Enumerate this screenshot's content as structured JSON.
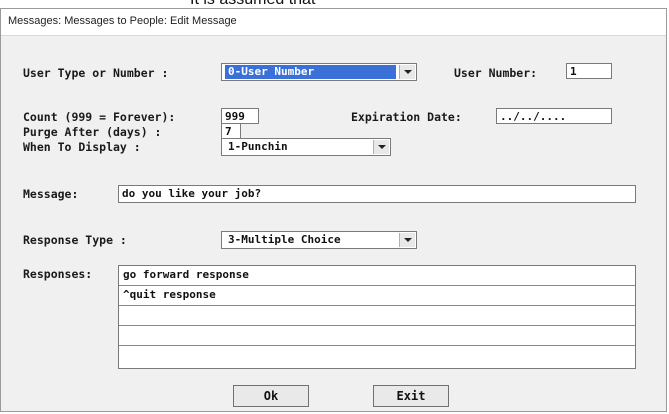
{
  "caption": "It is assumed that",
  "window": {
    "title": "Messages: Messages to People: Edit Message"
  },
  "form": {
    "user_type_label": "User Type or Number  :",
    "user_type_value": "0-User Number",
    "user_number_label": "User Number:",
    "user_number_value": "1",
    "count_label": "Count (999 = Forever):",
    "count_value": "999",
    "expiration_label": "Expiration Date:",
    "expiration_value": "../../....",
    "purge_label": "Purge After (days)   :",
    "purge_value": "7",
    "when_label": "When To Display      :",
    "when_value": "1-Punchin",
    "message_label": "Message:",
    "message_value": "do you like your job?",
    "response_type_label": "Response Type        :",
    "response_type_value": "3-Multiple Choice",
    "responses_label": "Responses:",
    "responses": [
      "go forward response",
      "^quit response",
      "",
      "",
      ""
    ]
  },
  "buttons": {
    "ok": "Ok",
    "exit": "Exit"
  }
}
